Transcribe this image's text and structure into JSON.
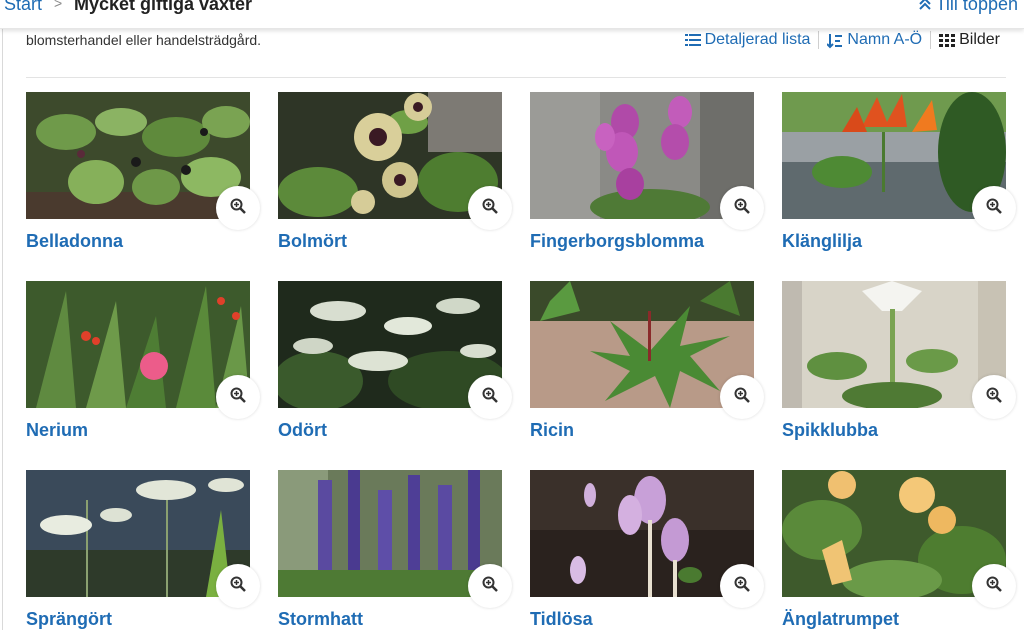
{
  "header": {
    "crumb_start": "Start",
    "crumb_separator": ">",
    "page_title": "Mycket giftiga växter",
    "to_top_label": "Till toppen",
    "to_top_icon": "double-chevron-up-icon"
  },
  "intro_text": "blomsterhandel eller handelsträdgård.",
  "view_controls": {
    "detailed_list": "Detaljerad lista",
    "sort_name": "Namn A-Ö",
    "images": "Bilder",
    "active": "images"
  },
  "colors": {
    "link": "#1f6cb4",
    "text": "#222222"
  },
  "plants": [
    {
      "name": "Belladonna",
      "zoom_icon": "zoom-in-icon"
    },
    {
      "name": "Bolmört",
      "zoom_icon": "zoom-in-icon"
    },
    {
      "name": "Fingerborgsblomma",
      "zoom_icon": "zoom-in-icon"
    },
    {
      "name": "Klänglilja",
      "zoom_icon": "zoom-in-icon"
    },
    {
      "name": "Nerium",
      "zoom_icon": "zoom-in-icon"
    },
    {
      "name": "Odört",
      "zoom_icon": "zoom-in-icon"
    },
    {
      "name": "Ricin",
      "zoom_icon": "zoom-in-icon"
    },
    {
      "name": "Spikklubba",
      "zoom_icon": "zoom-in-icon"
    },
    {
      "name": "Sprängört",
      "zoom_icon": "zoom-in-icon"
    },
    {
      "name": "Stormhatt",
      "zoom_icon": "zoom-in-icon"
    },
    {
      "name": "Tidlösa",
      "zoom_icon": "zoom-in-icon"
    },
    {
      "name": "Änglatrumpet",
      "zoom_icon": "zoom-in-icon"
    }
  ]
}
